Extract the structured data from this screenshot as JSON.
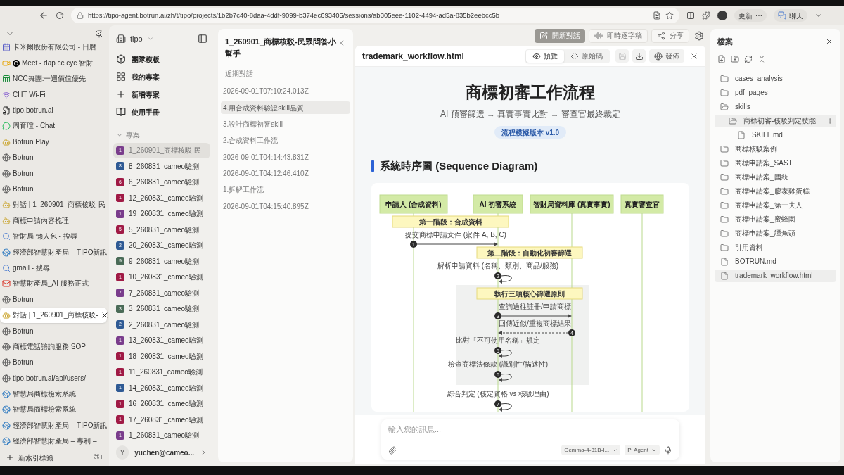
{
  "browser": {
    "url": "https://tipo-agent.botrun.ai/zh/t/tipo/projects/1b2b7c40-8daa-4ddf-9099-b374ec693405/sessions/ab305eee-1102-4494-ad5a-835b2eebcc5b",
    "update_label": "更新",
    "more_label": "⋯",
    "chat_label": "聊天"
  },
  "tabs": [
    {
      "title": "卡米爾股份有限公司 - 日曆",
      "kind": "calendar",
      "recording": false,
      "active": false
    },
    {
      "title": "Meet - dap cc cyc 智財",
      "kind": "video",
      "recording": true,
      "active": false
    },
    {
      "title": "NCC舞團:一週價值優先",
      "kind": "sheet",
      "recording": false,
      "active": false
    },
    {
      "title": "CHT Wi-Fi",
      "kind": "wifi",
      "recording": false,
      "active": false
    },
    {
      "title": "tipo.botrun.ai",
      "kind": "file",
      "recording": false,
      "active": false
    },
    {
      "title": "周育瑄 - Chat",
      "kind": "chat",
      "recording": false,
      "active": false
    },
    {
      "title": "Botrun Play",
      "kind": "bot",
      "recording": false,
      "active": false
    },
    {
      "title": "Botrun",
      "kind": "web",
      "recording": false,
      "active": false
    },
    {
      "title": "Botrun",
      "kind": "web",
      "recording": false,
      "active": false
    },
    {
      "title": "Botrun",
      "kind": "web",
      "recording": false,
      "active": false
    },
    {
      "title": "對話 | 1_260901_商標核駁-民",
      "kind": "bot",
      "recording": false,
      "active": false
    },
    {
      "title": "商標申請內容梳理",
      "kind": "bot",
      "recording": false,
      "active": false
    },
    {
      "title": "智財局 懶人包 - 搜尋",
      "kind": "search",
      "recording": false,
      "active": false
    },
    {
      "title": "經濟部智慧財產局 – TIPO新訊",
      "kind": "globe",
      "recording": false,
      "active": false
    },
    {
      "title": "gmail - 搜尋",
      "kind": "search",
      "recording": false,
      "active": false
    },
    {
      "title": "智慧財產局_AI 服務正式",
      "kind": "mail",
      "recording": false,
      "active": false
    },
    {
      "title": "Botrun",
      "kind": "web",
      "recording": false,
      "active": false
    },
    {
      "title": "對話 | 1_260901_商標核駁-",
      "kind": "bot",
      "recording": false,
      "active": true
    },
    {
      "title": "Botrun",
      "kind": "web",
      "recording": false,
      "active": false
    },
    {
      "title": "商標電話諮詢服務 SOP",
      "kind": "web",
      "recording": false,
      "active": false
    },
    {
      "title": "Botrun",
      "kind": "web",
      "recording": false,
      "active": false
    },
    {
      "title": "tipo.botrun.ai/api/users/",
      "kind": "web",
      "recording": false,
      "active": false
    },
    {
      "title": "智慧局商標檢索系統",
      "kind": "globe",
      "recording": false,
      "active": false
    },
    {
      "title": "智慧局商標檢索系統",
      "kind": "globe",
      "recording": false,
      "active": false
    },
    {
      "title": "經濟部智慧財產局 – TIPO新訊",
      "kind": "globe",
      "recording": false,
      "active": false
    },
    {
      "title": "經濟部智慧財產局 – 專利 –",
      "kind": "globe",
      "recording": false,
      "active": false
    }
  ],
  "new_tab": {
    "label": "新索引標籤",
    "shortcut": "⌘T"
  },
  "sidebar": {
    "workspace": "tipo",
    "menu": [
      {
        "label": "團隊模板",
        "kind": "cube"
      },
      {
        "label": "我的專案",
        "kind": "grid"
      },
      {
        "label": "新增專案",
        "kind": "plus"
      },
      {
        "label": "使用手冊",
        "kind": "book"
      }
    ],
    "section": "專案",
    "projects": [
      {
        "badge": "1",
        "name": "1_260901_商標核駁-民",
        "color": "#7a3d8c",
        "selected": true
      },
      {
        "badge": "8",
        "name": "8_260831_cameo驗測",
        "color": "#2f5a94",
        "selected": false
      },
      {
        "badge": "6",
        "name": "6_260831_cameo驗測",
        "color": "#a01a45",
        "selected": false
      },
      {
        "badge": "1",
        "name": "12_260831_cameo驗測",
        "color": "#a01a45",
        "selected": false
      },
      {
        "badge": "1",
        "name": "19_260831_cameo驗測",
        "color": "#7a3d8c",
        "selected": false
      },
      {
        "badge": "5",
        "name": "5_260831_cameo驗測",
        "color": "#a01a45",
        "selected": false
      },
      {
        "badge": "2",
        "name": "20_260831_cameo驗測",
        "color": "#2f5a94",
        "selected": false
      },
      {
        "badge": "9",
        "name": "9_260831_cameo驗測",
        "color": "#4a6b57",
        "selected": false
      },
      {
        "badge": "1",
        "name": "10_260831_cameo驗測",
        "color": "#a01a45",
        "selected": false
      },
      {
        "badge": "7",
        "name": "7_260831_cameo驗測",
        "color": "#7a3d8c",
        "selected": false
      },
      {
        "badge": "3",
        "name": "3_260831_cameo驗測",
        "color": "#4a6b57",
        "selected": false
      },
      {
        "badge": "2",
        "name": "2_260831_cameo驗測",
        "color": "#2f5a94",
        "selected": false
      },
      {
        "badge": "1",
        "name": "13_260831_cameo驗測",
        "color": "#7a3d8c",
        "selected": false
      },
      {
        "badge": "1",
        "name": "18_260831_cameo驗測",
        "color": "#a01a45",
        "selected": false
      },
      {
        "badge": "1",
        "name": "11_260831_cameo驗測",
        "color": "#a01a45",
        "selected": false
      },
      {
        "badge": "1",
        "name": "14_260831_cameo驗測",
        "color": "#2f5a94",
        "selected": false
      },
      {
        "badge": "1",
        "name": "16_260831_cameo驗測",
        "color": "#a01a45",
        "selected": false
      },
      {
        "badge": "1",
        "name": "17_260831_cameo驗測",
        "color": "#a01a45",
        "selected": false
      },
      {
        "badge": "1",
        "name": "1_260831_cameo驗測",
        "color": "#7a3d8c",
        "selected": false
      }
    ],
    "user": {
      "avatar": "Y",
      "email": "yuchen@cameo..."
    }
  },
  "conversations": {
    "title": "1_260901_商標核駁-民眾問答小幫手",
    "section": "近期對話",
    "items": [
      {
        "label": "2026-09-01T07:10:24.013Z",
        "selected": false
      },
      {
        "label": "4.用合成資料驗證skill品質",
        "selected": true
      },
      {
        "label": "3.設計商標初審skill",
        "selected": false
      },
      {
        "label": "2.合成資料工作流",
        "selected": false
      },
      {
        "label": "2026-09-01T04:14:43.831Z",
        "selected": false
      },
      {
        "label": "2026-09-01T04:12:46.410Z",
        "selected": false
      },
      {
        "label": "1.拆解工作流",
        "selected": false
      },
      {
        "label": "2026-09-01T04:15:40.895Z",
        "selected": false
      }
    ]
  },
  "actions": [
    {
      "label": "開新對話",
      "kind": "new",
      "filled": true
    },
    {
      "label": "即時逐字稿",
      "kind": "transcript",
      "filled": false
    },
    {
      "label": "分享",
      "kind": "share",
      "filled": false
    }
  ],
  "viewer": {
    "filename": "trademark_workflow.html",
    "modes": [
      {
        "label": "預覽",
        "kind": "preview",
        "selected": true
      },
      {
        "label": "原始碼",
        "kind": "code",
        "selected": false
      }
    ],
    "save_disabled": true,
    "publish_label": "發佈",
    "page": {
      "title": "商標初審工作流程",
      "subtitle": "AI 預審篩選 → 真實事實比對 → 審查官最終裁定",
      "badge": "流程模擬版本 v1.0",
      "heading": "系統時序圖 (Sequence Diagram)",
      "diagram": {
        "participants": [
          "申請人 (合成資料)",
          "AI 初審系統",
          "智財局資料庫 (真實事實)",
          "真實審查官"
        ],
        "steps": [
          {
            "kind": "note",
            "text": "第一階段：合成資料",
            "grouped": false
          },
          {
            "kind": "message",
            "number": "1",
            "text": "提交商標申請文件 (案件 A, B, C)",
            "grouped": false
          },
          {
            "kind": "note",
            "text": "第二階段：自動化初審篩選",
            "grouped": false
          },
          {
            "kind": "self",
            "number": "2",
            "text": "解析申請資料 (名稱、類別、商品/服務)",
            "grouped": false
          },
          {
            "kind": "note",
            "text": "執行三項核心篩選原則",
            "grouped": true
          },
          {
            "kind": "message",
            "number": "3",
            "text": "查詢過往註冊/申請商標",
            "grouped": true
          },
          {
            "kind": "reply",
            "number": "4",
            "text": "回傳近似/重複商標結果",
            "grouped": true
          },
          {
            "kind": "self",
            "number": "5",
            "text": "比對「不可使用名稱」規定",
            "grouped": true
          },
          {
            "kind": "self",
            "number": "6",
            "text": "檢查商標法條款 (識別性/描述性)",
            "grouped": true
          },
          {
            "kind": "self",
            "number": "7",
            "text": "綜合判定 (核定資格 vs 核駁理由)",
            "grouped": false
          }
        ]
      }
    }
  },
  "composer": {
    "placeholder": "輸入您的訊息...",
    "model": "Gemma-4-31B-I...",
    "agent": "Pi Agent"
  },
  "files": {
    "title": "檔案",
    "tree": [
      {
        "name": "cases_analysis",
        "kind": "folder",
        "expanded": false,
        "selected": false
      },
      {
        "name": "pdf_pages",
        "kind": "folder",
        "expanded": false,
        "selected": false
      },
      {
        "name": "skills",
        "kind": "folder",
        "expanded": true,
        "selected": false,
        "children": [
          {
            "name": "商標初審-核駁判定技能",
            "kind": "folder",
            "expanded": true,
            "selected": true,
            "children": [
              {
                "name": "SKILL.md",
                "kind": "file",
                "selected": false
              }
            ]
          }
        ]
      },
      {
        "name": "商標核駁案例",
        "kind": "folder",
        "expanded": false,
        "selected": false
      },
      {
        "name": "商標申請案_SAST",
        "kind": "folder",
        "expanded": false,
        "selected": false
      },
      {
        "name": "商標申請案_國統",
        "kind": "folder",
        "expanded": false,
        "selected": false
      },
      {
        "name": "商標申請案_廖家雞蛋糕",
        "kind": "folder",
        "expanded": false,
        "selected": false
      },
      {
        "name": "商標申請案_第一夫人",
        "kind": "folder",
        "expanded": false,
        "selected": false
      },
      {
        "name": "商標申請案_蜜蜂園",
        "kind": "folder",
        "expanded": false,
        "selected": false
      },
      {
        "name": "商標申請案_譚魚頭",
        "kind": "folder",
        "expanded": false,
        "selected": false
      },
      {
        "name": "引用資料",
        "kind": "folder",
        "expanded": false,
        "selected": false
      },
      {
        "name": "BOTRUN.md",
        "kind": "file",
        "selected": false
      },
      {
        "name": "trademark_workflow.html",
        "kind": "file",
        "selected": true
      }
    ]
  }
}
